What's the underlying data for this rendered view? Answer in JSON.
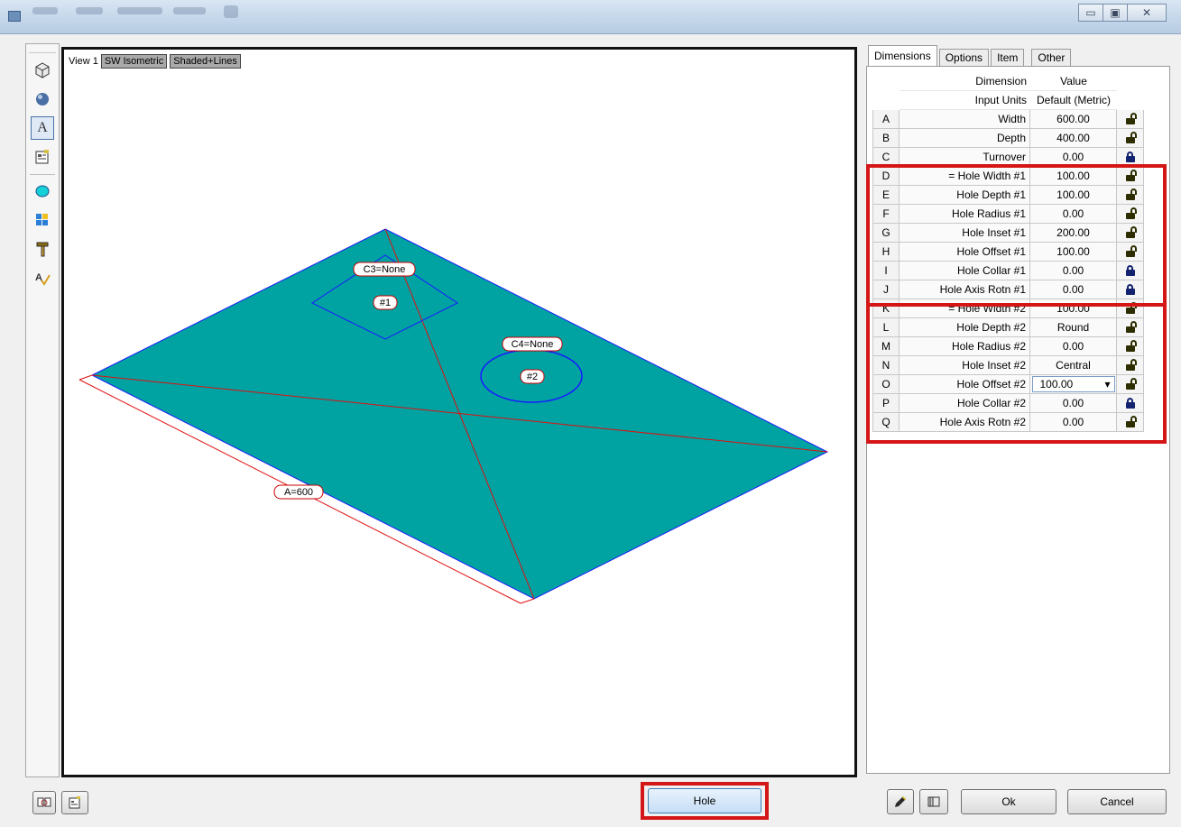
{
  "window": {
    "controls": {
      "minimize": "▭",
      "maximize": "▣",
      "close": "✕"
    }
  },
  "toolbar": {
    "icons": [
      "view-cube-icon",
      "sphere-icon",
      "text-icon",
      "properties-icon",
      "shape-icon",
      "layout-icon",
      "hammer-icon",
      "spell-icon"
    ],
    "text_tool": "A"
  },
  "viewport": {
    "view_label": "View 1",
    "view_mode": "SW Isometric",
    "render_mode": "Shaded+Lines",
    "tags": {
      "c3": "C3=None",
      "hole1": "#1",
      "c4": "C4=None",
      "hole2": "#2",
      "a": "A=600"
    },
    "colors": {
      "plate": "#00a2a2",
      "edge": "#1a1aff",
      "dimension": "#e01010"
    }
  },
  "tabs": [
    "Dimensions",
    "Options",
    "Item",
    "Other"
  ],
  "grid": {
    "header_dimension": "Dimension",
    "header_value": "Value",
    "header_input_units": "Input Units",
    "header_default": "Default (Metric)",
    "rows": [
      {
        "letter": "A",
        "name": "Width",
        "value": "600.00",
        "lock": "open"
      },
      {
        "letter": "B",
        "name": "Depth",
        "value": "400.00",
        "lock": "open"
      },
      {
        "letter": "C",
        "name": "Turnover",
        "value": "0.00",
        "lock": "closed"
      },
      {
        "letter": "D",
        "name": "= Hole Width #1",
        "value": "100.00",
        "lock": "open"
      },
      {
        "letter": "E",
        "name": "Hole Depth #1",
        "value": "100.00",
        "lock": "open"
      },
      {
        "letter": "F",
        "name": "Hole Radius #1",
        "value": "0.00",
        "lock": "open"
      },
      {
        "letter": "G",
        "name": "Hole Inset #1",
        "value": "200.00",
        "lock": "open"
      },
      {
        "letter": "H",
        "name": "Hole Offset #1",
        "value": "100.00",
        "lock": "open"
      },
      {
        "letter": "I",
        "name": "Hole Collar #1",
        "value": "0.00",
        "lock": "closed"
      },
      {
        "letter": "J",
        "name": "Hole Axis Rotn #1",
        "value": "0.00",
        "lock": "closed"
      },
      {
        "letter": "K",
        "name": "= Hole Width #2",
        "value": "100.00",
        "lock": "open"
      },
      {
        "letter": "L",
        "name": "Hole Depth #2",
        "value": "Round",
        "lock": "open"
      },
      {
        "letter": "M",
        "name": "Hole Radius #2",
        "value": "0.00",
        "lock": "open"
      },
      {
        "letter": "N",
        "name": "Hole Inset #2",
        "value": "Central",
        "lock": "open"
      },
      {
        "letter": "O",
        "name": "Hole Offset #2",
        "value": "100.00",
        "lock": "open",
        "editing": true
      },
      {
        "letter": "P",
        "name": "Hole Collar #2",
        "value": "0.00",
        "lock": "closed"
      },
      {
        "letter": "Q",
        "name": "Hole Axis Rotn #2",
        "value": "0.00",
        "lock": "open"
      }
    ]
  },
  "bottom": {
    "hole_label": "Hole",
    "ok_label": "Ok",
    "cancel_label": "Cancel"
  },
  "accent": {
    "highlight": "#d41616"
  }
}
